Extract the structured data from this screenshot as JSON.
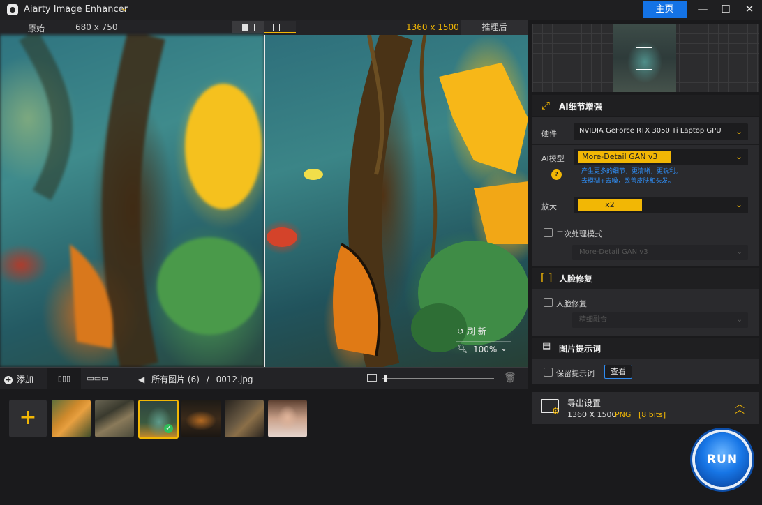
{
  "window": {
    "title": "Aiarty Image Enhancer",
    "home_label": "主页",
    "minimize_glyph": "—",
    "maximize_glyph": "☐",
    "close_glyph": "✕"
  },
  "compare": {
    "original_label": "原始",
    "original_size": "680 x 750",
    "result_size": "1360 x 1500",
    "result_label": "推理后",
    "refresh_label": "刷  新",
    "zoom_value": "100%"
  },
  "toolbar": {
    "add_label": "添加",
    "grid_view_glyph": "▯▯▯",
    "film_view_glyph": "▭▭▭",
    "breadcrumb_all": "所有图片 (6)",
    "breadcrumb_sep": "/",
    "breadcrumb_file": "0012.jpg",
    "zoom_slider_value": 0.02
  },
  "thumbnails": [
    {
      "name": "tiger",
      "selected": false
    },
    {
      "name": "butterfly",
      "selected": false
    },
    {
      "name": "jar-forest",
      "selected": true
    },
    {
      "name": "burger",
      "selected": false
    },
    {
      "name": "wolf",
      "selected": false
    },
    {
      "name": "portrait",
      "selected": false
    }
  ],
  "ai_detail": {
    "title": "AI细节增强",
    "hardware_label": "硬件",
    "hardware_value": "NVIDIA GeForce RTX 3050 Ti Laptop GPU",
    "model_label": "AI模型",
    "model_value": "More-Detail GAN  v3",
    "model_desc_1": "产生更多的细节，更清晰，更锐利。",
    "model_desc_2": "去模糊+去噪，改善皮肤和头发。",
    "scale_label": "放大",
    "scale_value": "x2",
    "secondary_label": "二次处理模式",
    "secondary_value": "More-Detail GAN  v3"
  },
  "face": {
    "title": "人脸修复",
    "check_label": "人脸修复",
    "mode_value": "精细融合"
  },
  "prompt": {
    "title": "图片提示词",
    "keep_label": "保留提示词",
    "view_label": "查看"
  },
  "export": {
    "title": "导出设置",
    "size": "1360 X 1500",
    "format": "PNG",
    "bits": "[8 bits]"
  },
  "run_label": "RUN",
  "colors": {
    "accent": "#f2b705",
    "primary_blue": "#1473e6",
    "panel_bg": "#2a2a2d",
    "desc_blue": "#2f8bf0"
  }
}
